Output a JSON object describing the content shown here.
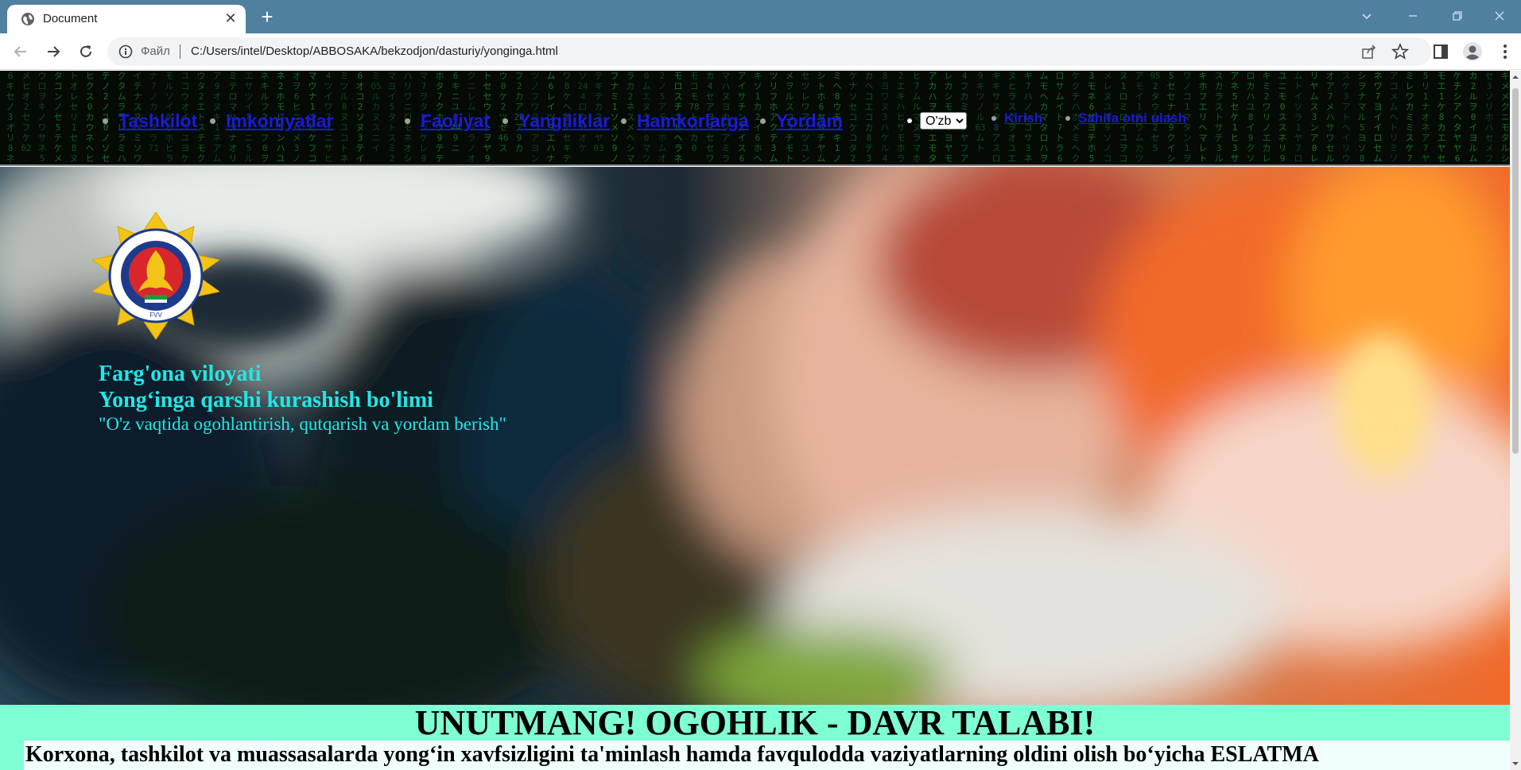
{
  "browser": {
    "tab_title": "Document",
    "new_tab_label": "+",
    "address": {
      "scheme_label": "Файл",
      "url": "C:/Users/intel/Desktop/ABBOSAKA/bekzodjon/dasturiy/yonginga.html"
    }
  },
  "nav": {
    "items": [
      {
        "label": "Tashkilot"
      },
      {
        "label": "Imkoniyatlar"
      },
      {
        "label": "Faoliyat"
      },
      {
        "label": "Yangiliklar"
      },
      {
        "label": "Hamkorlarga"
      },
      {
        "label": "Yordam"
      }
    ],
    "language_selected": "O'zb",
    "login_label": "Kirish",
    "share_label": "Sahifa otni ulash"
  },
  "hero": {
    "line1": "Farg'ona viloyati",
    "line2": "Yong‘inga qarshi kurashish bo'limi",
    "line3": "\"O'z vaqtida ogohlantirish, qutqarish va yordam berish\"",
    "emblem_text": "FAVQULODDA VAZIYATLAR VAZIRLIGI",
    "emblem_abbr": "FVV"
  },
  "alert": {
    "title": "UNUTMANG! OGOHLIK - DAVR TALABI!",
    "subtitle": "Korxona, tashkilot va muassasalarda yong‘in xavfsizligini ta'minlash hamda favqulodda vaziyatlarning oldini olish bo‘yicha ESLATMA"
  },
  "colors": {
    "tabbar": "#4f80a0",
    "nav_bg": "#050a05",
    "matrix_green": "#1b7a2a",
    "link": "#1a1ad8",
    "hero_text": "#20e8e8",
    "alert_bg": "#7fffd4"
  },
  "icons": {
    "tab_favicon": "globe-icon",
    "back": "arrow-left-icon",
    "forward": "arrow-right-icon",
    "reload": "reload-icon",
    "info": "info-icon",
    "share": "share-icon",
    "bookmark": "star-icon",
    "sidepanel": "side-panel-icon",
    "profile": "profile-icon",
    "menu": "kebab-menu-icon"
  }
}
